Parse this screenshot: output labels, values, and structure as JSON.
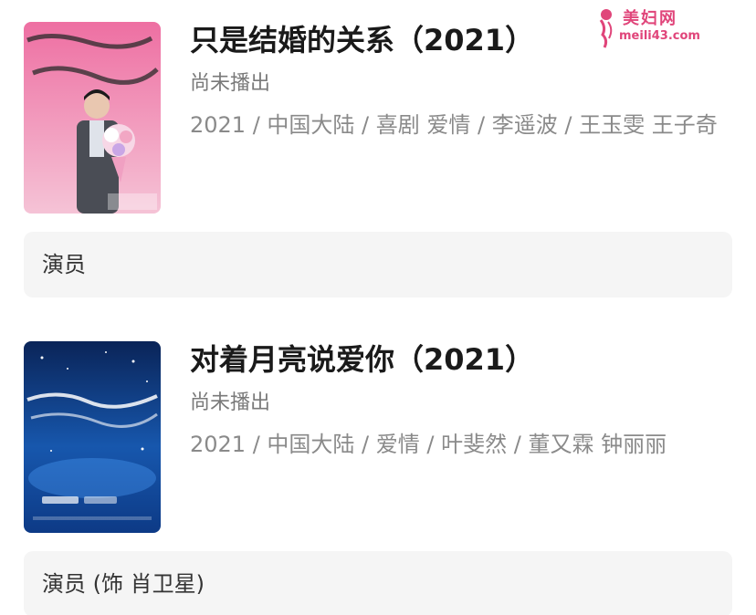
{
  "watermark": {
    "brand": "美妇网",
    "url": "meili43.com"
  },
  "items": [
    {
      "title": "只是结婚的关系（2021）",
      "status": "尚未播出",
      "meta": "2021 / 中国大陆 / 喜剧 爱情 / 李遥波 / 王玉雯 王子奇",
      "role": "演员",
      "poster_colors": [
        "#f07aa8",
        "#f3b0c8"
      ]
    },
    {
      "title": "对着月亮说爱你（2021）",
      "status": "尚未播出",
      "meta": "2021 / 中国大陆 / 爱情 / 叶斐然 / 董又霖 钟丽丽",
      "role": "演员 (饰 肖卫星)",
      "poster_colors": [
        "#0b2a6e",
        "#1b5fb8"
      ]
    }
  ]
}
